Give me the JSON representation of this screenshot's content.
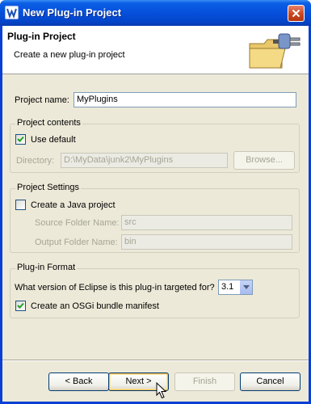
{
  "window": {
    "title": "New Plug-in Project"
  },
  "banner": {
    "title": "Plug-in Project",
    "description": "Create a new plug-in project"
  },
  "project_name": {
    "label": "Project name:",
    "value": "MyPlugins"
  },
  "project_contents": {
    "title": "Project contents",
    "use_default_label": "Use default",
    "use_default_checked": true,
    "directory_label": "Directory:",
    "directory_value": "D:\\MyData\\junk2\\MyPlugins",
    "browse_label": "Browse..."
  },
  "project_settings": {
    "title": "Project Settings",
    "java_label": "Create a Java project",
    "java_checked": false,
    "source_label": "Source Folder Name:",
    "source_value": "src",
    "output_label": "Output Folder Name:",
    "output_value": "bin"
  },
  "plugin_format": {
    "title": "Plug-in Format",
    "version_question": "What version of Eclipse is this plug-in targeted for?",
    "version_value": "3.1",
    "osgi_label": "Create an OSGi bundle manifest",
    "osgi_checked": true
  },
  "buttons": {
    "back": "< Back",
    "next": "Next >",
    "finish": "Finish",
    "cancel": "Cancel"
  },
  "icons": {
    "app": "eclipse-plugin-icon",
    "close": "close-icon",
    "wizard": "plugin-folder-icon",
    "cursor": "mouse-pointer-icon"
  }
}
